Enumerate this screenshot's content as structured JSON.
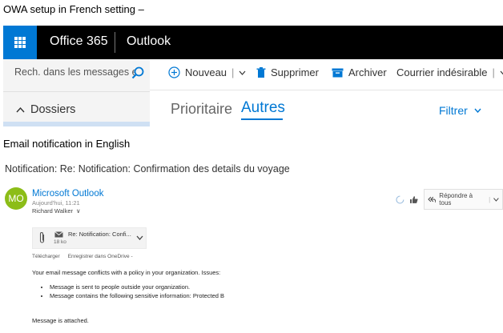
{
  "captions": {
    "owa": "OWA setup in French setting –",
    "email": "Email notification in English"
  },
  "owa": {
    "brand": "Office 365",
    "app": "Outlook",
    "search_placeholder": "Rech. dans les messages e...",
    "folders_label": "Dossiers",
    "toolbar": {
      "new": "Nouveau",
      "delete": "Supprimer",
      "archive": "Archiver",
      "junk": "Courrier indésirable"
    },
    "pivots": {
      "focused": "Prioritaire",
      "other": "Autres"
    },
    "filter": "Filtrer",
    "accent": "#0078d4"
  },
  "email": {
    "subject": "Notification: Re: Notification: Confirmation des details du voyage",
    "avatar_initials": "MO",
    "avatar_color": "#8cbd18",
    "sender": "Microsoft Outlook",
    "date": "Aujourd'hui, 11:21",
    "recipient": "Richard Walker",
    "reply_all": "Répondre à tous",
    "attachment": {
      "name": "Re: Notification: Confi...",
      "size": "18 ko",
      "download": "Télécharger",
      "save_onedrive": "Enregistrer dans OneDrive -"
    },
    "body": "Your email message conflicts with a policy in your organization. Issues:",
    "issues": [
      "Message is sent to people outside your organization.",
      "Message contains the following sensitive information: Protected B"
    ],
    "closing": "Message is attached."
  }
}
